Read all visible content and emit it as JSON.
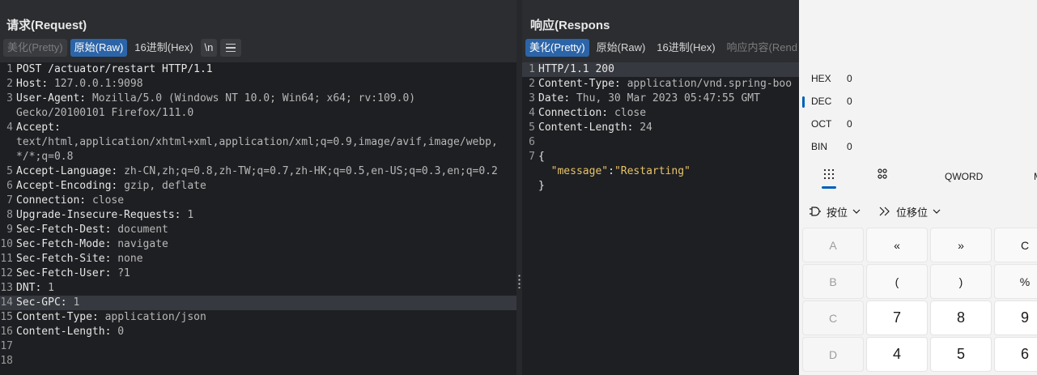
{
  "request": {
    "title": "请求(Request)",
    "tabs": [
      {
        "label": "美化(Pretty)",
        "state": "disabled"
      },
      {
        "label": "原始(Raw)",
        "state": "active"
      },
      {
        "label": "16进制(Hex)",
        "state": "normal"
      },
      {
        "label": "\\n",
        "state": "outline"
      }
    ],
    "lines": [
      {
        "n": "1",
        "text": "POST /actuator/restart HTTP/1.1"
      },
      {
        "n": "2",
        "k": "Host",
        "v": "127.0.0.1:9098"
      },
      {
        "n": "3",
        "k": "User-Agent",
        "v": "Mozilla/5.0 (Windows NT 10.0; Win64; x64; rv:109.0)\nGecko/20100101 Firefox/111.0"
      },
      {
        "n": "4",
        "k": "Accept",
        "v": "\ntext/html,application/xhtml+xml,application/xml;q=0.9,image/avif,image/webp,\n*/*;q=0.8"
      },
      {
        "n": "5",
        "k": "Accept-Language",
        "v": "zh-CN,zh;q=0.8,zh-TW;q=0.7,zh-HK;q=0.5,en-US;q=0.3,en;q=0.2"
      },
      {
        "n": "6",
        "k": "Accept-Encoding",
        "v": "gzip, deflate"
      },
      {
        "n": "7",
        "k": "Connection",
        "v": "close"
      },
      {
        "n": "8",
        "k": "Upgrade-Insecure-Requests",
        "v": "1"
      },
      {
        "n": "9",
        "k": "Sec-Fetch-Dest",
        "v": "document"
      },
      {
        "n": "10",
        "k": "Sec-Fetch-Mode",
        "v": "navigate"
      },
      {
        "n": "11",
        "k": "Sec-Fetch-Site",
        "v": "none"
      },
      {
        "n": "12",
        "k": "Sec-Fetch-User",
        "v": "?1"
      },
      {
        "n": "13",
        "k": "DNT",
        "v": "1"
      },
      {
        "n": "14",
        "k": "Sec-GPC",
        "v": "1",
        "highlight": true
      },
      {
        "n": "15",
        "k": "Content-Type",
        "v": "application/json"
      },
      {
        "n": "16",
        "k": "Content-Length",
        "v": "0"
      },
      {
        "n": "17",
        "text": ""
      },
      {
        "n": "18",
        "text": ""
      }
    ]
  },
  "response": {
    "title": "响应(Respons",
    "tabs": [
      {
        "label": "美化(Pretty)",
        "state": "active"
      },
      {
        "label": "原始(Raw)",
        "state": "normal"
      },
      {
        "label": "16进制(Hex)",
        "state": "normal"
      },
      {
        "label": "响应内容(Rend",
        "state": "dim"
      }
    ],
    "lines": [
      {
        "n": "1",
        "text": "HTTP/1.1 200",
        "highlight": true
      },
      {
        "n": "2",
        "k": "Content-Type",
        "v": "application/vnd.spring-boo"
      },
      {
        "n": "3",
        "k": "Date",
        "v": "Thu, 30 Mar 2023 05:47:55 GMT"
      },
      {
        "n": "4",
        "k": "Connection",
        "v": "close"
      },
      {
        "n": "5",
        "k": "Content-Length",
        "v": "24"
      },
      {
        "n": "6",
        "text": ""
      },
      {
        "n": "7",
        "text": "{"
      }
    ],
    "json_key": "\"message\"",
    "json_colon": ":",
    "json_value": "\"Restarting\"",
    "json_close": "}"
  },
  "calculator": {
    "radix": [
      {
        "label": "HEX",
        "value": "0"
      },
      {
        "label": "DEC",
        "value": "0",
        "selected": true
      },
      {
        "label": "OCT",
        "value": "0"
      },
      {
        "label": "BIN",
        "value": "0"
      }
    ],
    "tabs": {
      "keypad_icon": "keypad-icon",
      "bitflip_icon": "bit-toggle-icon",
      "word_size": "QWORD",
      "memory": "M"
    },
    "bitwise_label": "按位",
    "bitshift_label": "位移位",
    "keys": [
      [
        "A",
        "«",
        "»",
        "C"
      ],
      [
        "B",
        "(",
        ")",
        "%"
      ],
      [
        "C",
        "7",
        "8",
        "9"
      ],
      [
        "D",
        "4",
        "5",
        "6"
      ]
    ]
  }
}
